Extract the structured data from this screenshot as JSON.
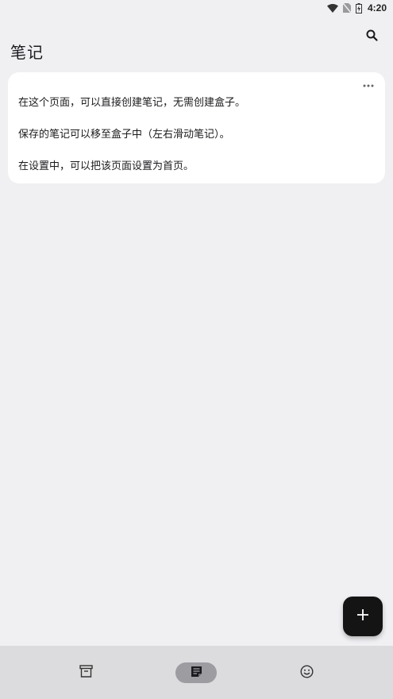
{
  "status_bar": {
    "time": "4:20",
    "icons": [
      "wifi-icon",
      "no-sim-icon",
      "battery-charging-icon"
    ]
  },
  "header": {
    "title": "笔记",
    "search_icon": "search-icon"
  },
  "note": {
    "more_icon": "more-horizontal-icon",
    "lines": [
      "在这个页面，可以直接创建笔记，无需创建盒子。",
      "保存的笔记可以移至盒子中（左右滑动笔记）。",
      "在设置中，可以把该页面设置为首页。"
    ]
  },
  "fab": {
    "icon": "plus-icon"
  },
  "bottom_nav": {
    "items": [
      {
        "icon": "archive-box-icon",
        "active": false
      },
      {
        "icon": "note-icon",
        "active": true
      },
      {
        "icon": "smiley-icon",
        "active": false
      }
    ],
    "active_color": "#9c9ca1"
  },
  "colors": {
    "background": "#f0f0f3",
    "card": "#ffffff",
    "fab": "#141414",
    "nav_bar": "#dcdcdf"
  }
}
